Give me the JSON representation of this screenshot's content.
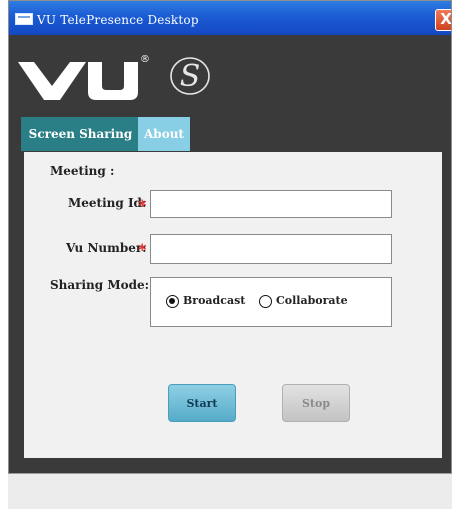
{
  "window": {
    "title": "VU TelePresence Desktop",
    "close_label": "X"
  },
  "logo": {
    "brand": "VU",
    "registered": "®",
    "badge_letter": "S"
  },
  "tabs": [
    {
      "label": "Screen Sharing",
      "active": true
    },
    {
      "label": "About",
      "active": false
    }
  ],
  "form": {
    "section_title": "Meeting :",
    "meeting_id": {
      "label": "Meeting Id:",
      "value": "",
      "required_mark": "*"
    },
    "vu_number": {
      "label": "Vu Number:",
      "value": "",
      "required_mark": "*"
    },
    "sharing_mode": {
      "label": "Sharing Mode:",
      "options": [
        {
          "label": "Broadcast",
          "selected": true
        },
        {
          "label": "Collaborate",
          "selected": false
        }
      ]
    }
  },
  "buttons": {
    "start": "Start",
    "stop": "Stop"
  },
  "colors": {
    "title_bar": "#1b5bd3",
    "active_tab": "#2a7f86",
    "inactive_tab": "#88cfe6",
    "required": "#e23030",
    "start_button": "#56acc9"
  }
}
